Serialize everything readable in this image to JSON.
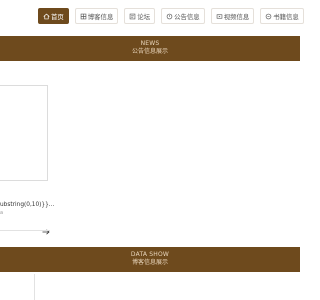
{
  "nav": {
    "items": [
      {
        "label": "首页",
        "icon": "home-icon",
        "active": true
      },
      {
        "label": "博客信息",
        "icon": "grid-icon",
        "active": false
      },
      {
        "label": "论坛",
        "icon": "forum-icon",
        "active": false
      },
      {
        "label": "公告信息",
        "icon": "bell-icon",
        "active": false
      },
      {
        "label": "视频信息",
        "icon": "video-icon",
        "active": false
      },
      {
        "label": "书籍信息",
        "icon": "book-icon",
        "active": false
      }
    ]
  },
  "news_section": {
    "title_en": "NEWS",
    "title_zh": "公告信息展示"
  },
  "news_card": {
    "text": "ubstring(0,10)}}...",
    "sub": "a"
  },
  "data_section": {
    "title_en": "DATA SHOW",
    "title_zh": "博客信息展示"
  },
  "colors": {
    "accent": "#6e4a1d",
    "band_text": "#e9d6bd"
  }
}
